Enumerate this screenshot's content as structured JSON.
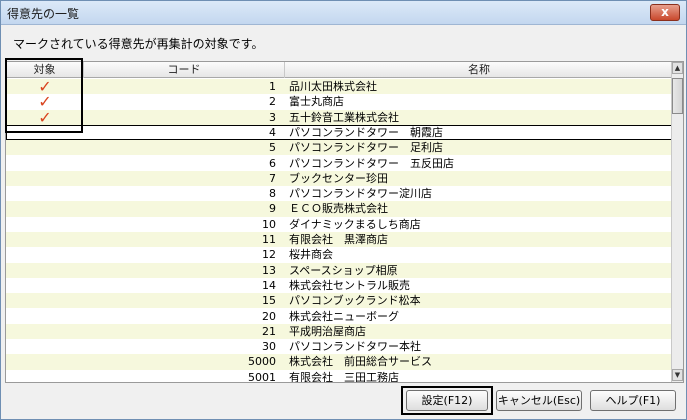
{
  "window": {
    "title": "得意先の一覧",
    "close_label": "x"
  },
  "message": "マークされている得意先が再集計の対象です。",
  "columns": {
    "mark": "対象",
    "code": "コード",
    "name": "名称"
  },
  "check_glyph": "✓",
  "rows": [
    {
      "marked": true,
      "code": "1",
      "name": "品川太田株式会社"
    },
    {
      "marked": true,
      "code": "2",
      "name": "富士丸商店"
    },
    {
      "marked": true,
      "code": "3",
      "name": "五十鈴音工業株式会社"
    },
    {
      "marked": false,
      "code": "4",
      "name": "パソコンランドタワー　朝霞店"
    },
    {
      "marked": false,
      "code": "5",
      "name": "パソコンランドタワー　足利店"
    },
    {
      "marked": false,
      "code": "6",
      "name": "パソコンランドタワー　五反田店"
    },
    {
      "marked": false,
      "code": "7",
      "name": "ブックセンター珍田"
    },
    {
      "marked": false,
      "code": "8",
      "name": "パソコンランドタワー淀川店"
    },
    {
      "marked": false,
      "code": "9",
      "name": "ＥＣＯ販売株式会社"
    },
    {
      "marked": false,
      "code": "10",
      "name": "ダイナミックまるしち商店"
    },
    {
      "marked": false,
      "code": "11",
      "name": "有限会社　黒澤商店"
    },
    {
      "marked": false,
      "code": "12",
      "name": "桜井商会"
    },
    {
      "marked": false,
      "code": "13",
      "name": "スペースショップ相原"
    },
    {
      "marked": false,
      "code": "14",
      "name": "株式会社セントラル販売"
    },
    {
      "marked": false,
      "code": "15",
      "name": "パソコンブックランド松本"
    },
    {
      "marked": false,
      "code": "20",
      "name": "株式会社ニューボーグ"
    },
    {
      "marked": false,
      "code": "21",
      "name": "平成明治屋商店"
    },
    {
      "marked": false,
      "code": "30",
      "name": "パソコンランドタワー本社"
    },
    {
      "marked": false,
      "code": "5000",
      "name": "株式会社　前田総合サービス"
    },
    {
      "marked": false,
      "code": "5001",
      "name": "有限会社　三田工務店"
    }
  ],
  "selected_row_index": 3,
  "scrollbar": {
    "up": "▲",
    "down": "▼"
  },
  "buttons": {
    "ok": "設定(F12)",
    "cancel": "キャンセル(Esc)",
    "help": "ヘルプ(F1)"
  },
  "colors": {
    "check": "#d9431e",
    "alt_row": "#f6f8dd"
  }
}
